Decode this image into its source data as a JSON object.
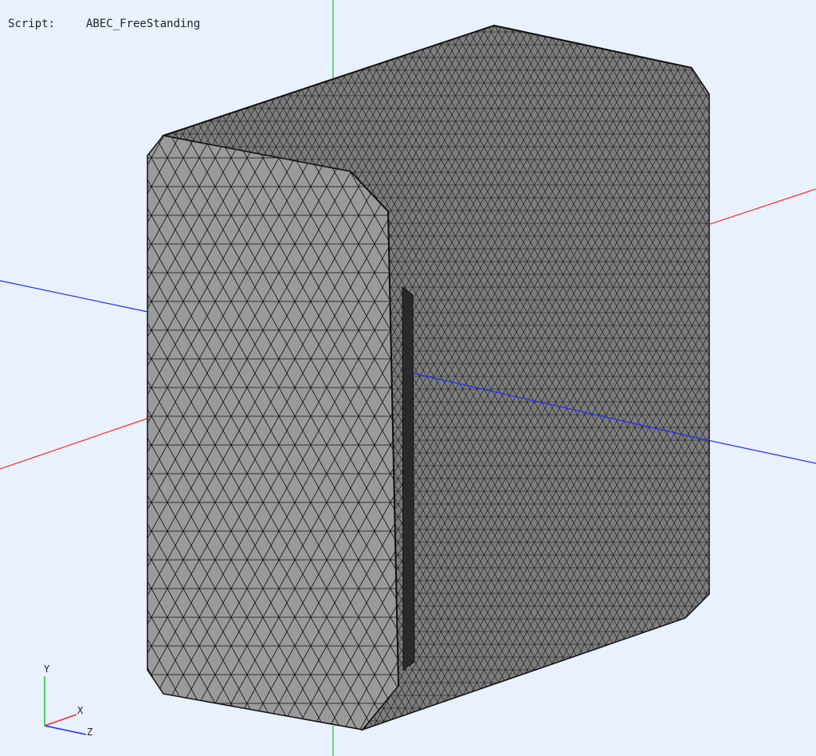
{
  "overlay": {
    "script_label": "Script:",
    "script_name": "ABEC_FreeStanding"
  },
  "triad": {
    "x_label": "X",
    "y_label": "Y",
    "z_label": "Z"
  },
  "colors": {
    "background": "#e8f1fd",
    "mesh_fill_front": "#9a9a9a",
    "mesh_fill_side": "#7d7d7d",
    "mesh_lines": "#111111",
    "axis_x": "#ff2a2a",
    "axis_y": "#1ec41e",
    "axis_z": "#1f2cff"
  },
  "icons": {
    "triad": "xyz-axes-icon",
    "mesh": "wireframe-mesh-icon"
  }
}
